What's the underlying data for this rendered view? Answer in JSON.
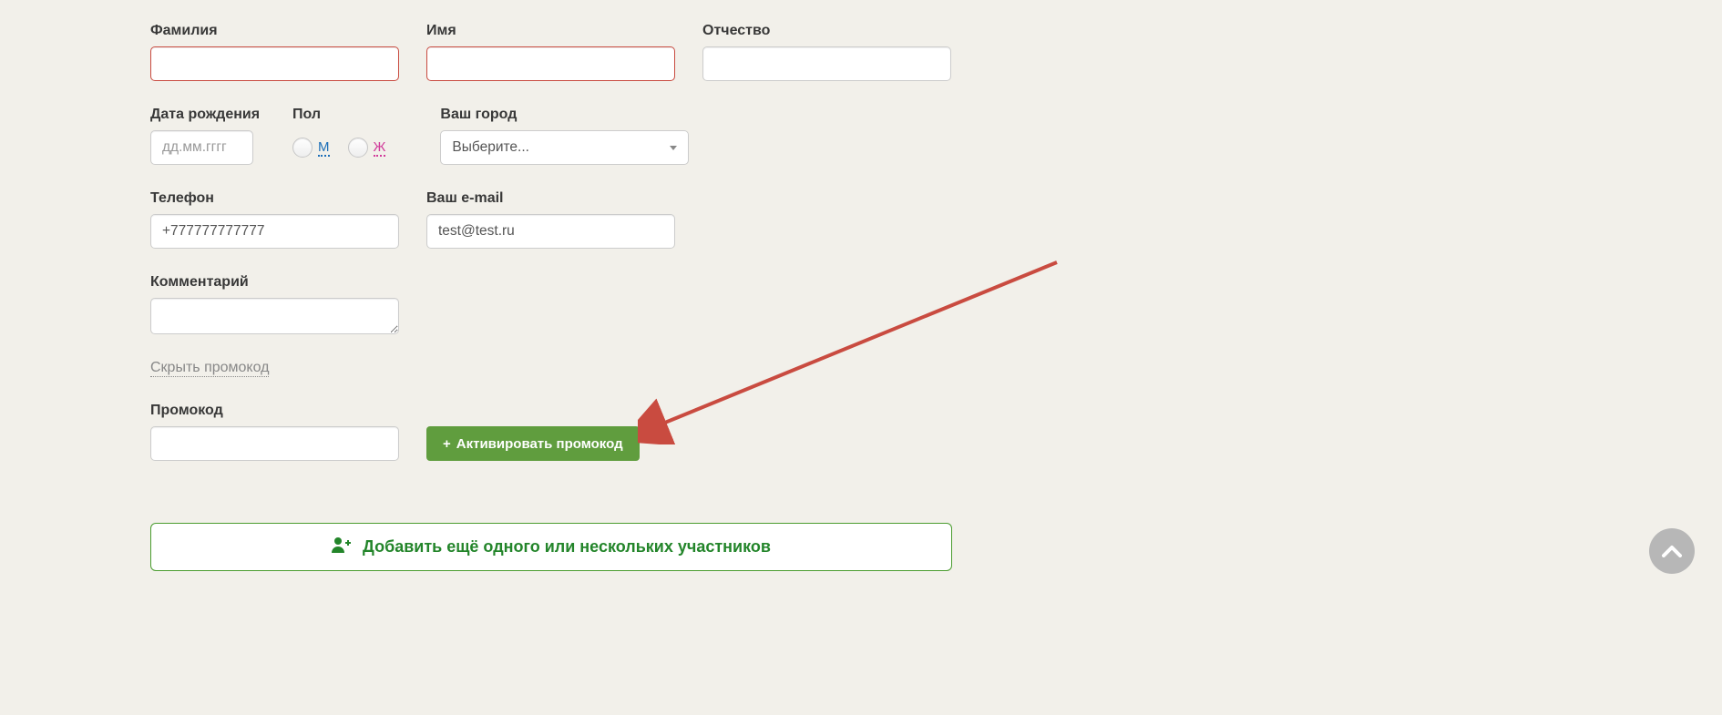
{
  "fields": {
    "lastname_label": "Фамилия",
    "firstname_label": "Имя",
    "patronymic_label": "Отчество",
    "birthdate_label": "Дата рождения",
    "birthdate_placeholder": "дд.мм.гггг",
    "gender_label": "Пол",
    "gender_male": "М",
    "gender_female": "Ж",
    "city_label": "Ваш город",
    "city_placeholder": "Выберите...",
    "phone_label": "Телефон",
    "phone_value": "+777777777777",
    "email_label": "Ваш e-mail",
    "email_value": "test@test.ru",
    "comment_label": "Комментарий",
    "promo_toggle": "Скрыть промокод",
    "promo_label": "Промокод"
  },
  "buttons": {
    "activate_promo": "Активировать промокод",
    "add_more": "Добавить ещё одного или нескольких участников"
  }
}
